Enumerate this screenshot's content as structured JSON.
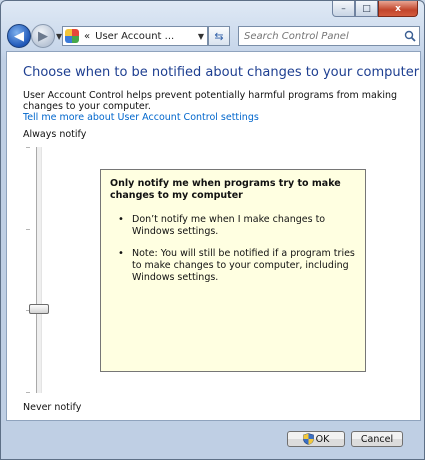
{
  "window": {
    "caption_buttons": {
      "minimize": "–",
      "maximize": "□",
      "close": "x"
    }
  },
  "nav": {
    "back_icon": "arrow-left",
    "forward_icon": "arrow-right",
    "recent_icon": "chevron-down",
    "address_separator": "«",
    "address_text": "User Account ...",
    "refresh_icon": "refresh-arrows",
    "search_placeholder": "Search Control Panel"
  },
  "main": {
    "heading": "Choose when to be notified about changes to your computer",
    "description": "User Account Control helps prevent potentially harmful programs from making changes to your computer.",
    "link": "Tell me more about User Account Control settings",
    "slider": {
      "top_label": "Always notify",
      "bottom_label": "Never notify",
      "levels": 4,
      "selected_level": 2
    },
    "tooltip": {
      "title": "Only notify me when programs try to make changes to my computer",
      "bullets": [
        "Don’t notify me when I make changes to Windows settings.",
        "Note: You will still be notified if a program tries to make changes to your computer, including Windows settings."
      ]
    }
  },
  "footer": {
    "ok_label": "OK",
    "cancel_label": "Cancel"
  },
  "colors": {
    "heading": "#1e3f91",
    "link": "#0066cc",
    "tooltip_bg": "#ffffe1"
  }
}
